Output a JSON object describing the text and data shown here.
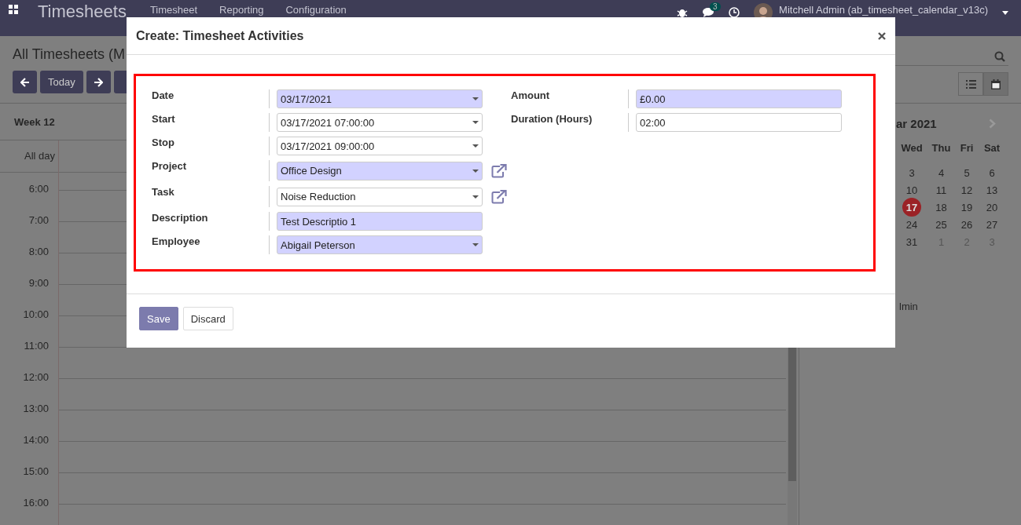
{
  "navbar": {
    "brand": "Timesheets",
    "menus": [
      "Timesheet",
      "Reporting",
      "Configuration"
    ],
    "message_count": "3",
    "user": "Mitchell Admin (ab_timesheet_calendar_v13c)"
  },
  "control_panel": {
    "breadcrumb": "All Timesheets (M",
    "buttons": [
      {
        "kind": "prev"
      },
      {
        "kind": "text",
        "label": "Today"
      },
      {
        "kind": "next"
      },
      {
        "kind": "hidden"
      }
    ],
    "views": [
      {
        "kind": "list",
        "selected": false
      },
      {
        "kind": "calendar",
        "selected": true
      }
    ]
  },
  "calendar": {
    "week": "Week 12",
    "all_day": "All day",
    "hours": [
      "6:00",
      "7:00",
      "8:00",
      "9:00",
      "10:00",
      "11:00",
      "12:00",
      "13:00",
      "14:00",
      "15:00",
      "16:00"
    ]
  },
  "mini_calendar": {
    "month": "ar 2021",
    "weekdays": [
      "Wed",
      "Thu",
      "Fri",
      "Sat"
    ],
    "days": [
      {
        "label": "3",
        "selected": false,
        "other_month": false
      },
      {
        "label": "4",
        "selected": false,
        "other_month": false
      },
      {
        "label": "5",
        "selected": false,
        "other_month": false
      },
      {
        "label": "6",
        "selected": false,
        "other_month": false
      },
      {
        "label": "10",
        "selected": false,
        "other_month": false
      },
      {
        "label": "11",
        "selected": false,
        "other_month": false
      },
      {
        "label": "12",
        "selected": false,
        "other_month": false
      },
      {
        "label": "13",
        "selected": false,
        "other_month": false
      },
      {
        "label": "17",
        "selected": true,
        "other_month": false
      },
      {
        "label": "18",
        "selected": false,
        "other_month": false
      },
      {
        "label": "19",
        "selected": false,
        "other_month": false
      },
      {
        "label": "20",
        "selected": false,
        "other_month": false
      },
      {
        "label": "24",
        "selected": false,
        "other_month": false
      },
      {
        "label": "25",
        "selected": false,
        "other_month": false
      },
      {
        "label": "26",
        "selected": false,
        "other_month": false
      },
      {
        "label": "27",
        "selected": false,
        "other_month": false
      },
      {
        "label": "31",
        "selected": false,
        "other_month": false
      },
      {
        "label": "1",
        "selected": false,
        "other_month": true
      },
      {
        "label": "2",
        "selected": false,
        "other_month": true
      },
      {
        "label": "3",
        "selected": false,
        "other_month": true
      }
    ],
    "attendee": "lmin"
  },
  "dialog": {
    "title": "Create: Timesheet Activities",
    "left_fields": [
      {
        "label": "Date",
        "kind": "dropdown",
        "value": "03/17/2021",
        "required": true,
        "link": false
      },
      {
        "label": "Start",
        "kind": "dropdown",
        "value": "03/17/2021 07:00:00",
        "required": false,
        "link": false
      },
      {
        "label": "Stop",
        "kind": "dropdown",
        "value": "03/17/2021 09:00:00",
        "required": false,
        "link": false
      },
      {
        "label": "Project",
        "kind": "dropdown",
        "value": "Office Design",
        "required": true,
        "link": true
      },
      {
        "label": "Task",
        "kind": "dropdown",
        "value": "Noise Reduction",
        "required": false,
        "link": true
      },
      {
        "label": "Description",
        "kind": "text",
        "value": "Test Descriptio 1",
        "required": true,
        "link": false
      },
      {
        "label": "Employee",
        "kind": "dropdown",
        "value": "Abigail Peterson",
        "required": true,
        "link": false
      }
    ],
    "right_fields": [
      {
        "label": "Amount",
        "kind": "text",
        "value": "£0.00",
        "required": true,
        "link": false
      },
      {
        "label": "Duration (Hours)",
        "kind": "text",
        "value": "02:00",
        "required": false,
        "link": false
      }
    ],
    "buttons": [
      {
        "label": "Save",
        "kind": "primary"
      },
      {
        "label": "Discard",
        "kind": "secondary"
      }
    ]
  }
}
